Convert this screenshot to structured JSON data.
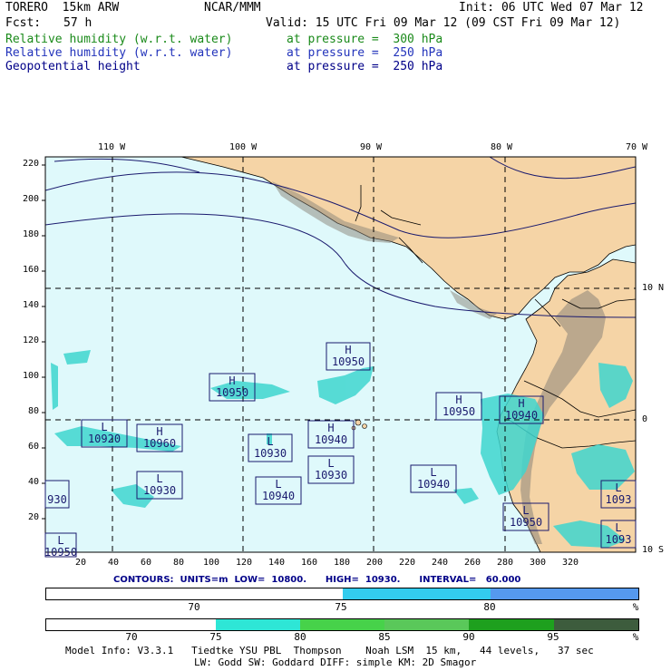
{
  "header": {
    "model": "TORERO  15km ARW",
    "center": "NCAR/MMM",
    "init": "Init: 06 UTC Wed 07 Mar 12",
    "fcst_label": "Fcst:",
    "fcst_value": "57 h",
    "valid": "Valid: 15 UTC Fri 09 Mar 12 (09 CST Fri 09 Mar 12)"
  },
  "fields": [
    {
      "name": "Relative humidity (w.r.t. water)",
      "level": "at pressure =  300 hPa",
      "color": "#1a8a1a"
    },
    {
      "name": "Relative humidity (w.r.t. water)",
      "level": "at pressure =  250 hPa",
      "color": "#2233bb"
    },
    {
      "name": "Geopotential height",
      "level": "at pressure =  250 hPa",
      "color": "#000088"
    }
  ],
  "map": {
    "lon_labels": [
      "110 W",
      "100 W",
      "90 W",
      "80 W",
      "70 W"
    ],
    "lat_labels": [
      "10 N",
      "0",
      "10 S"
    ],
    "y_ticks": [
      "220",
      "200",
      "180",
      "160",
      "140",
      "120",
      "100",
      "80",
      "60",
      "40",
      "20"
    ],
    "x_ticks": [
      "20",
      "40",
      "60",
      "80",
      "100",
      "120",
      "140",
      "160",
      "180",
      "200",
      "220",
      "240",
      "260",
      "280",
      "300",
      "320"
    ],
    "colors": {
      "ocean": "#dff9fb",
      "land": "#f5d4a6",
      "mountain": "#8a8478",
      "moist": "#3fd6cf",
      "contour": "#1a1a6e"
    },
    "pressure_centers": [
      {
        "type": "H",
        "value": "10950"
      },
      {
        "type": "H",
        "value": "10950"
      },
      {
        "type": "H",
        "value": "10950"
      },
      {
        "type": "H",
        "value": "10940"
      },
      {
        "type": "L",
        "value": "10920"
      },
      {
        "type": "H",
        "value": "10960"
      },
      {
        "type": "L",
        "value": "10930"
      },
      {
        "type": "H",
        "value": "10940"
      },
      {
        "type": "L",
        "value": "10930"
      },
      {
        "type": "L",
        "value": "10930"
      },
      {
        "type": "L",
        "value": "10940"
      },
      {
        "type": "L",
        "value": "10940"
      },
      {
        "type": "L",
        "value": "10950"
      },
      {
        "type": "",
        "value": "930"
      },
      {
        "type": "L",
        "value": "1093"
      },
      {
        "type": "L",
        "value": "1093"
      },
      {
        "type": "L",
        "value": "10950"
      }
    ]
  },
  "contours_line": "CONTOURS:  UNITS=m  LOW=  10800.      HIGH=  10930.      INTERVAL=   60.000",
  "colorbar_250": {
    "labels": [
      "70",
      "75",
      "80",
      "%"
    ],
    "colors": [
      "#ffffff",
      "#ffffff",
      "#33ccee",
      "#5599ee"
    ]
  },
  "colorbar_300": {
    "labels": [
      "70",
      "75",
      "80",
      "85",
      "90",
      "95",
      "%"
    ],
    "colors": [
      "#ffffff",
      "#ffffff",
      "#2ee6d6",
      "#47d24a",
      "#5ac85a",
      "#1ea01e",
      "#3d5c3d"
    ]
  },
  "footer": {
    "line1": "Model Info: V3.3.1   Tiedtke YSU PBL  Thompson    Noah LSM  15 km,   44 levels,   37 sec",
    "line2": "LW: Godd SW: Goddard DIFF: simple KM: 2D Smagor"
  }
}
